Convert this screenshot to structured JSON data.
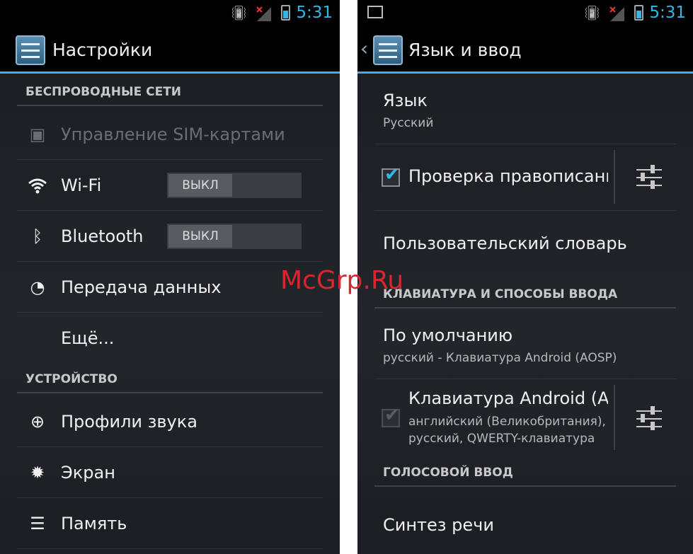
{
  "left": {
    "status": {
      "clock": "5:31"
    },
    "actionbar": {
      "title": "Настройки"
    },
    "sections": {
      "wireless": "БЕСПРОВОДНЫЕ СЕТИ",
      "device": "УСТРОЙСТВО"
    },
    "items": {
      "sim": "Управление SIM-картами",
      "wifi": "Wi-Fi",
      "wifi_toggle": "ВЫКЛ",
      "bluetooth": "Bluetooth",
      "bluetooth_toggle": "ВЫКЛ",
      "data": "Передача данных",
      "more": "Ещё...",
      "sound": "Профили звука",
      "screen": "Экран",
      "memory": "Память"
    }
  },
  "right": {
    "status": {
      "clock": "5:31"
    },
    "actionbar": {
      "title": "Язык и ввод"
    },
    "items": {
      "language": "Язык",
      "language_value": "Русский",
      "spellcheck": "Проверка правописани",
      "user_dict": "Пользовательский словарь",
      "default": "По умолчанию",
      "default_value": "русский - Клавиатура Android (AOSP)",
      "android_kb": "Клавиатура Android (A",
      "android_kb_line1": "английский (Великобритания),",
      "android_kb_line2": "русский, QWERTY-клавиатура",
      "tts": "Синтез речи"
    },
    "sections": {
      "keyboard": "КЛАВИАТУРА И СПОСОБЫ ВВОДА",
      "voice": "ГОЛОСОВОЙ ВВОД"
    }
  },
  "watermark": "McGrp.Ru",
  "colors": {
    "accent": "#33b5e5",
    "watermark": "#d8262c"
  }
}
